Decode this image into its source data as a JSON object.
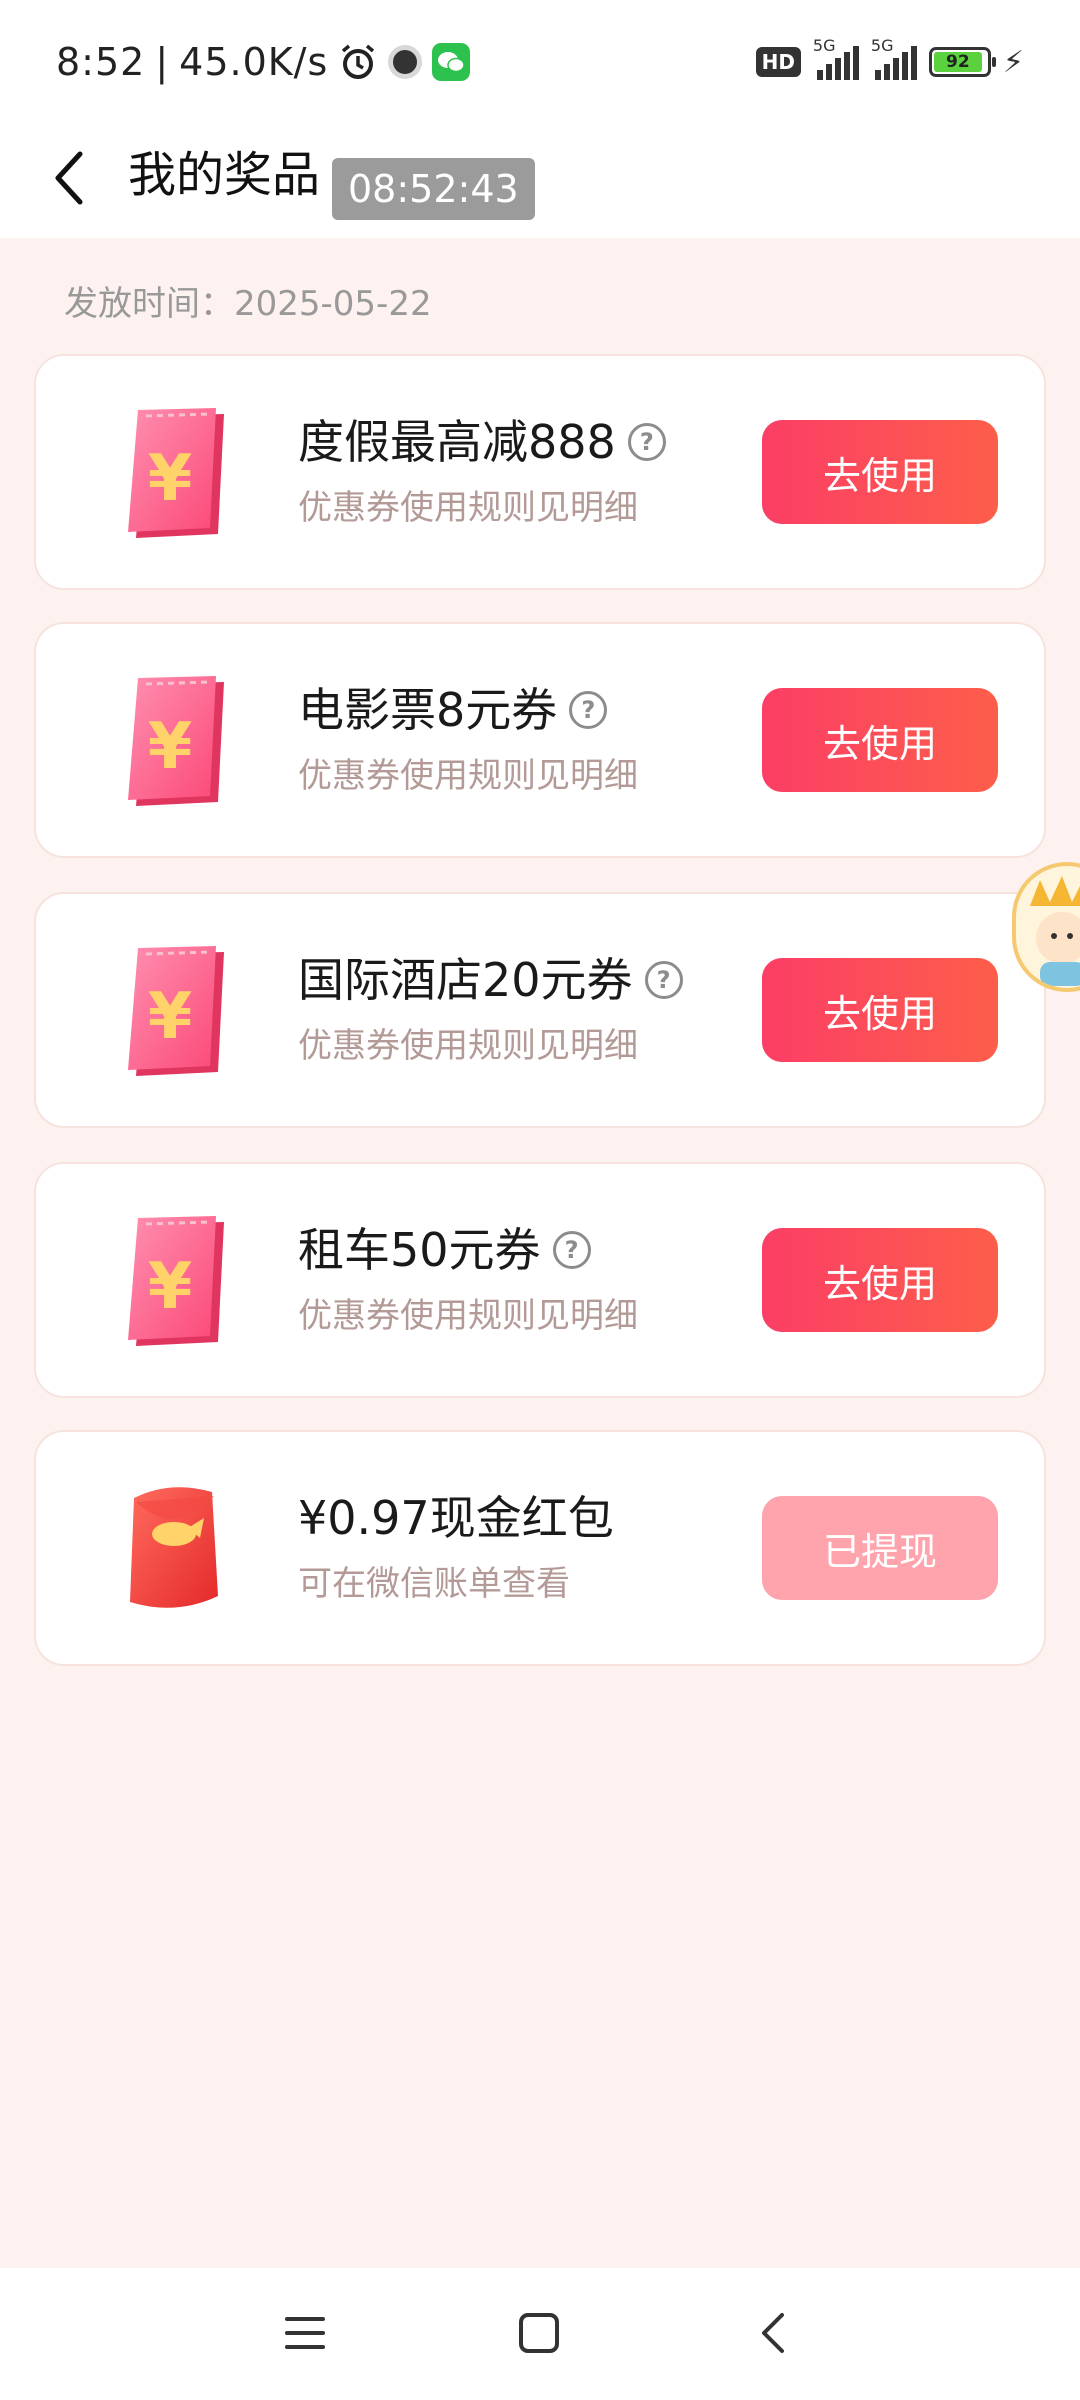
{
  "status_bar": {
    "time": "8:52",
    "network_speed": "45.0K/s",
    "hd_label": "HD",
    "signal_1_label": "5G",
    "signal_2_label": "5G",
    "battery_level": "92",
    "icons": [
      "alarm-icon",
      "dot-app-icon",
      "wechat-icon",
      "signal-icon",
      "battery-icon",
      "charging-icon"
    ]
  },
  "header": {
    "title": "我的奖品",
    "time_chip": "08:52:43"
  },
  "issue_date": {
    "label": "发放时间：",
    "value": "2025-05-22"
  },
  "prizes": [
    {
      "name": "度假最高减888",
      "desc": "优惠券使用规则见明细",
      "action": "去使用",
      "has_help": true,
      "icon": "coupon-icon"
    },
    {
      "name": "电影票8元券",
      "desc": "优惠券使用规则见明细",
      "action": "去使用",
      "has_help": true,
      "icon": "coupon-icon"
    },
    {
      "name": "国际酒店20元券",
      "desc": "优惠券使用规则见明细",
      "action": "去使用",
      "has_help": true,
      "icon": "coupon-icon"
    },
    {
      "name": "租车50元券",
      "desc": "优惠券使用规则见明细",
      "action": "去使用",
      "has_help": true,
      "icon": "coupon-icon"
    },
    {
      "name": "¥0.97现金红包",
      "desc": "可在微信账单查看",
      "action": "已提现",
      "has_help": false,
      "icon": "red-envelope-icon"
    }
  ],
  "colors": {
    "background": "#fdf2ef",
    "button_gradient_start": "#fb3e66",
    "button_gradient_end": "#fd5e4a",
    "button_disabled": "#ffa3ad",
    "desc_text": "#b39a96"
  }
}
